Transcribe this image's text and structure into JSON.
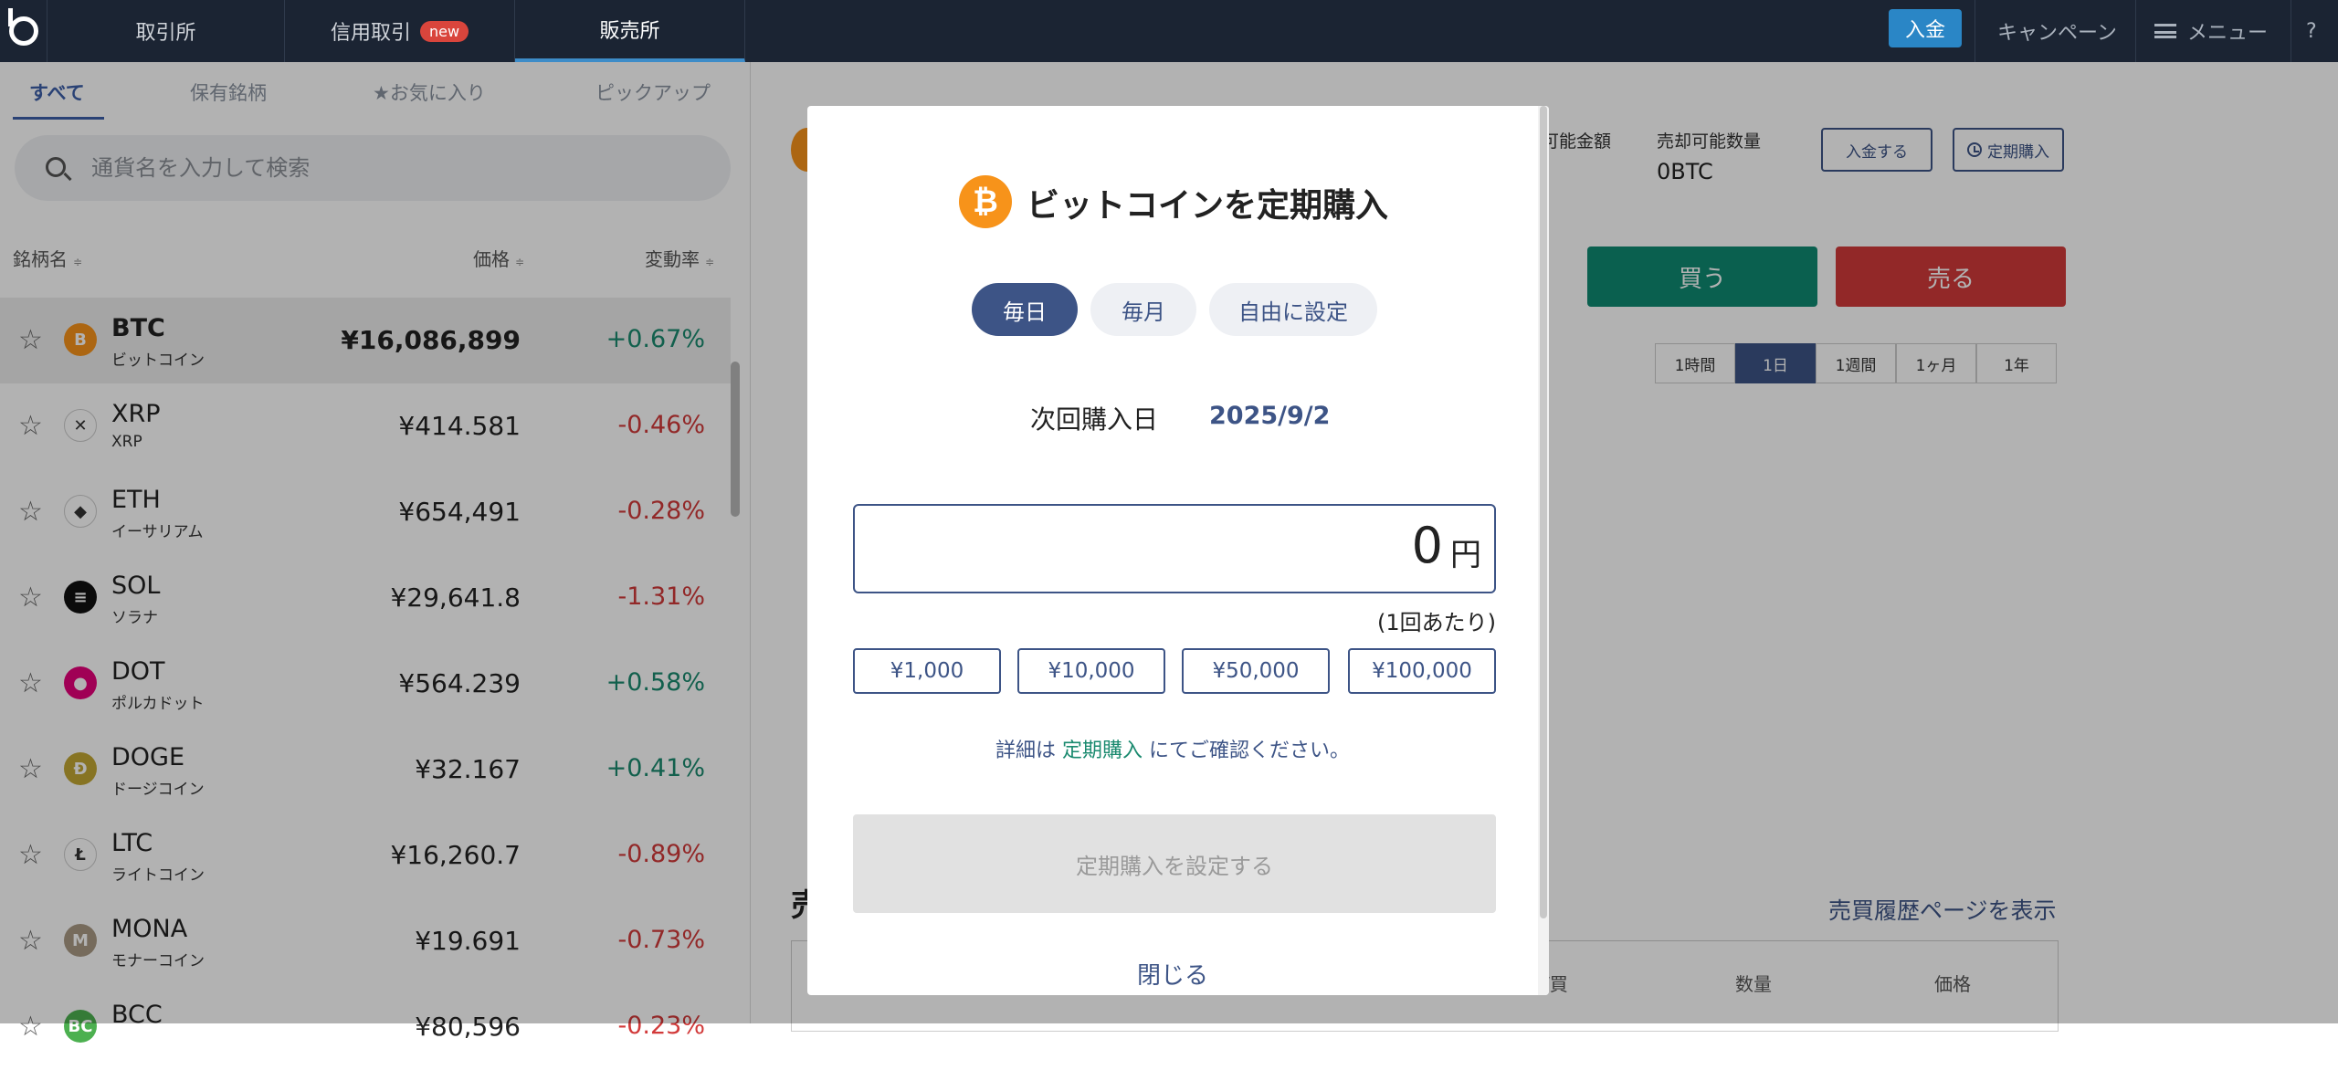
{
  "topbar": {
    "tabs": [
      "取引所",
      "信用取引",
      "販売所"
    ],
    "new_badge": "new",
    "deposit": "入金",
    "campaign": "キャンペーン",
    "menu": "メニュー",
    "help": "?"
  },
  "sidebar": {
    "tabs": [
      "すべて",
      "保有銘柄",
      "★お気に入り",
      "ピックアップ"
    ],
    "search_placeholder": "通貨名を入力して検索",
    "columns": [
      "銘柄名",
      "価格",
      "変動率"
    ],
    "sort_glyph": "≑",
    "coins": [
      {
        "sym": "BTC",
        "name": "ビットコイン",
        "price": "¥16,086,899",
        "change": "+0.67%",
        "icon": "B",
        "color": "#f7931a"
      },
      {
        "sym": "XRP",
        "name": "XRP",
        "price": "¥414.581",
        "change": "-0.46%",
        "icon": "✕",
        "color": "#ffffff"
      },
      {
        "sym": "ETH",
        "name": "イーサリアム",
        "price": "¥654,491",
        "change": "-0.28%",
        "icon": "◆",
        "color": "#ffffff"
      },
      {
        "sym": "SOL",
        "name": "ソラナ",
        "price": "¥29,641.8",
        "change": "-1.31%",
        "icon": "≡",
        "color": "#111111"
      },
      {
        "sym": "DOT",
        "name": "ポルカドット",
        "price": "¥564.239",
        "change": "+0.58%",
        "icon": "●",
        "color": "#e6007a"
      },
      {
        "sym": "DOGE",
        "name": "ドージコイン",
        "price": "¥32.167",
        "change": "+0.41%",
        "icon": "Ð",
        "color": "#c2a633"
      },
      {
        "sym": "LTC",
        "name": "ライトコイン",
        "price": "¥16,260.7",
        "change": "-0.89%",
        "icon": "Ł",
        "color": "#ffffff"
      },
      {
        "sym": "MONA",
        "name": "モナーコイン",
        "price": "¥19.691",
        "change": "-0.73%",
        "icon": "M",
        "color": "#a99a85"
      },
      {
        "sym": "BCC",
        "name": "",
        "price": "¥80,596",
        "change": "-0.23%",
        "icon": "BC",
        "color": "#4cb050"
      }
    ]
  },
  "main": {
    "available_amount": "可能金額",
    "sellable_qty_label": "売却可能数量",
    "sellable_qty": "0BTC",
    "deposit_btn": "入金する",
    "recurring_btn": "定期購入",
    "buy": "買う",
    "sell": "売る",
    "periods": [
      "1時間",
      "1日",
      "1週間",
      "1ヶ月",
      "1年"
    ],
    "history_title": "売",
    "history_link": "売買履歴ページを表示",
    "history_cols": [
      "/買",
      "数量",
      "価格"
    ]
  },
  "modal": {
    "title": "ビットコインを定期購入",
    "frequencies": [
      "毎日",
      "毎月",
      "自由に設定"
    ],
    "next_label": "次回購入日",
    "next_date": "2025/9/2",
    "amount": "0",
    "unit": "円",
    "per": "(1回あたり)",
    "quick": [
      "¥1,000",
      "¥10,000",
      "¥50,000",
      "¥100,000"
    ],
    "note_before": "詳細は",
    "note_link": "定期購入",
    "note_after": "にてご確認ください。",
    "submit": "定期購入を設定する",
    "close": "閉じる"
  }
}
